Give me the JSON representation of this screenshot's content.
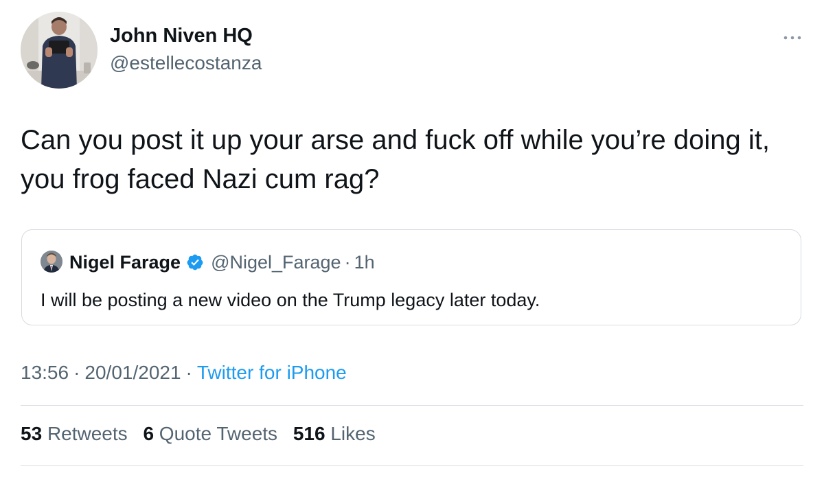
{
  "author": {
    "name": "John Niven HQ",
    "handle": "@estellecostanza"
  },
  "tweet": {
    "text": "Can you post it up your arse and fuck off while you’re doing it, you frog faced Nazi cum rag?"
  },
  "quoted_tweet": {
    "name": "Nigel Farage",
    "handle": "@Nigel_Farage",
    "separator": "·",
    "time": "1h",
    "text": "I will be posting a new video on the Trump legacy later today.",
    "verified": true
  },
  "meta": {
    "time": "13:56",
    "separator": "·",
    "date": "20/01/2021",
    "source": "Twitter for iPhone"
  },
  "stats": {
    "retweets": {
      "count": "53",
      "label": "Retweets"
    },
    "quote_tweets": {
      "count": "6",
      "label": "Quote Tweets"
    },
    "likes": {
      "count": "516",
      "label": "Likes"
    }
  },
  "icons": {
    "more": "more-horizontal-icon",
    "verified": "verified-badge-icon"
  },
  "colors": {
    "text_primary": "#0f1419",
    "text_secondary": "#536471",
    "link": "#1d9bf0",
    "verified": "#1d9bf0",
    "border": "#d6dbe0"
  }
}
